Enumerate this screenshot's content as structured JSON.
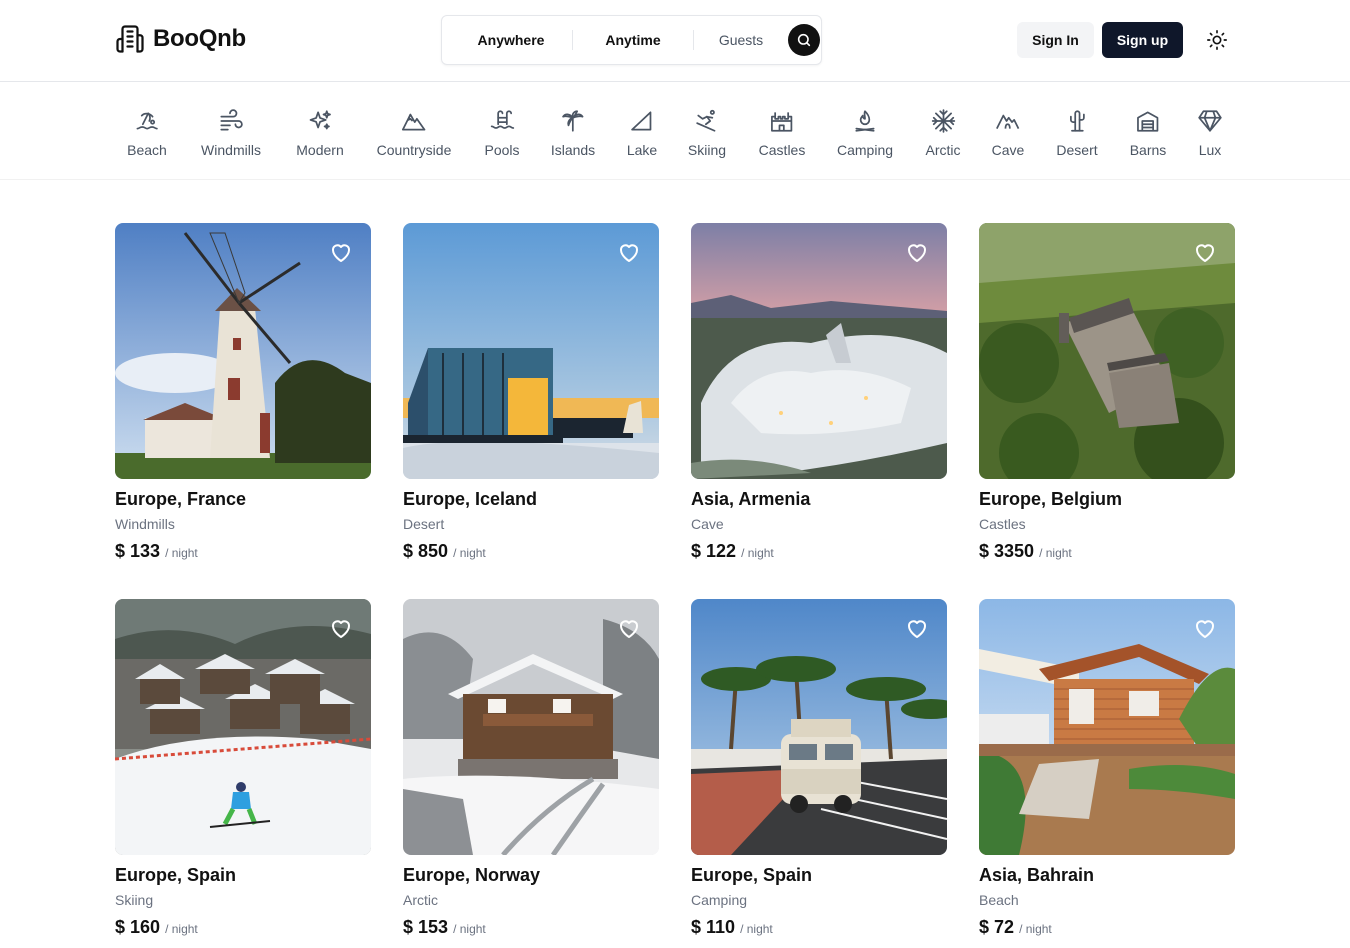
{
  "brand": {
    "name": "BooQnb"
  },
  "search": {
    "anywhere": "Anywhere",
    "anytime": "Anytime",
    "guests": "Guests"
  },
  "auth": {
    "sign_in": "Sign In",
    "sign_up": "Sign up"
  },
  "categories": [
    {
      "label": "Beach",
      "icon": "beach-icon"
    },
    {
      "label": "Windmills",
      "icon": "wind-icon"
    },
    {
      "label": "Modern",
      "icon": "sparkles-icon"
    },
    {
      "label": "Countryside",
      "icon": "mountain-icon"
    },
    {
      "label": "Pools",
      "icon": "pool-icon"
    },
    {
      "label": "Islands",
      "icon": "palm-icon"
    },
    {
      "label": "Lake",
      "icon": "sail-icon"
    },
    {
      "label": "Skiing",
      "icon": "skier-icon"
    },
    {
      "label": "Castles",
      "icon": "castle-icon"
    },
    {
      "label": "Camping",
      "icon": "campfire-icon"
    },
    {
      "label": "Arctic",
      "icon": "snowflake-icon"
    },
    {
      "label": "Cave",
      "icon": "cave-icon"
    },
    {
      "label": "Desert",
      "icon": "cactus-icon"
    },
    {
      "label": "Barns",
      "icon": "barn-icon"
    },
    {
      "label": "Lux",
      "icon": "diamond-icon"
    }
  ],
  "listings": [
    {
      "location": "Europe, France",
      "category": "Windmills",
      "price": "$ 133",
      "per": "/ night"
    },
    {
      "location": "Europe, Iceland",
      "category": "Desert",
      "price": "$ 850",
      "per": "/ night"
    },
    {
      "location": "Asia, Armenia",
      "category": "Cave",
      "price": "$ 122",
      "per": "/ night"
    },
    {
      "location": "Europe, Belgium",
      "category": "Castles",
      "price": "$ 3350",
      "per": "/ night"
    },
    {
      "location": "Europe, Spain",
      "category": "Skiing",
      "price": "$ 160",
      "per": "/ night"
    },
    {
      "location": "Europe, Norway",
      "category": "Arctic",
      "price": "$ 153",
      "per": "/ night"
    },
    {
      "location": "Europe, Spain",
      "category": "Camping",
      "price": "$ 110",
      "per": "/ night"
    },
    {
      "location": "Asia, Bahrain",
      "category": "Beach",
      "price": "$ 72",
      "per": "/ night"
    }
  ],
  "colors": {
    "primary_dark": "#0f172a",
    "muted_text": "#6b7280",
    "border": "#e5e7eb"
  }
}
